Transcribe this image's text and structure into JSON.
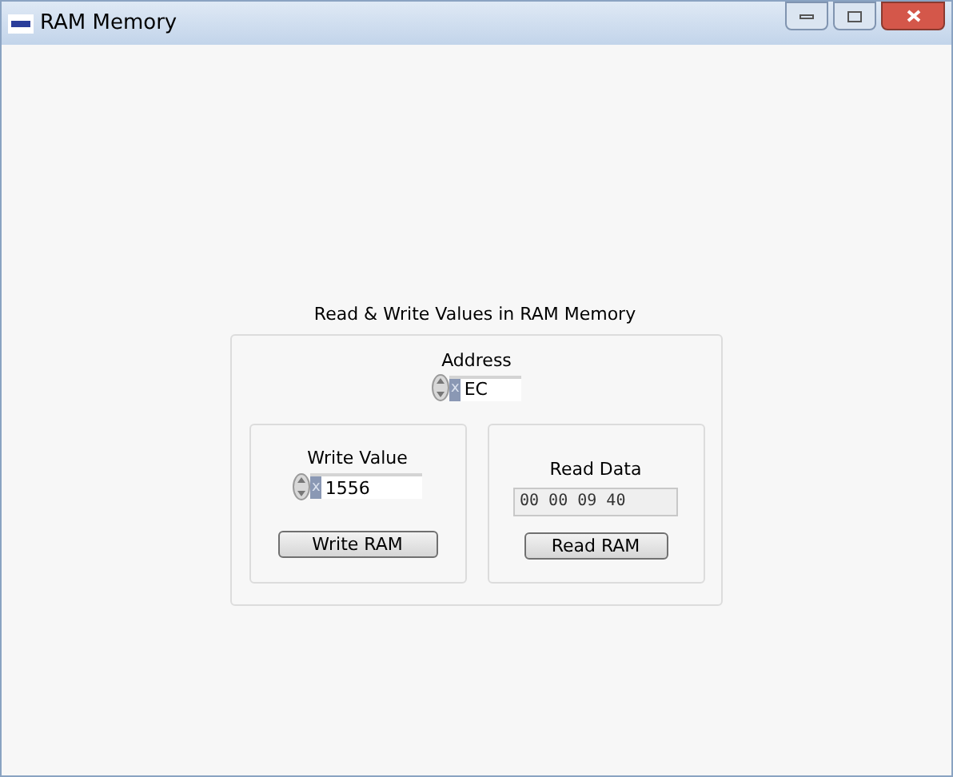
{
  "window": {
    "title": "RAM Memory"
  },
  "group": {
    "title": "Read & Write Values in RAM Memory",
    "address": {
      "label": "Address",
      "radix": "x",
      "value": "EC"
    },
    "write": {
      "label": "Write Value",
      "radix": "x",
      "value": "1556",
      "button": "Write RAM"
    },
    "read": {
      "label": "Read Data",
      "value": "00 00 09 40",
      "button": "Read RAM"
    }
  }
}
